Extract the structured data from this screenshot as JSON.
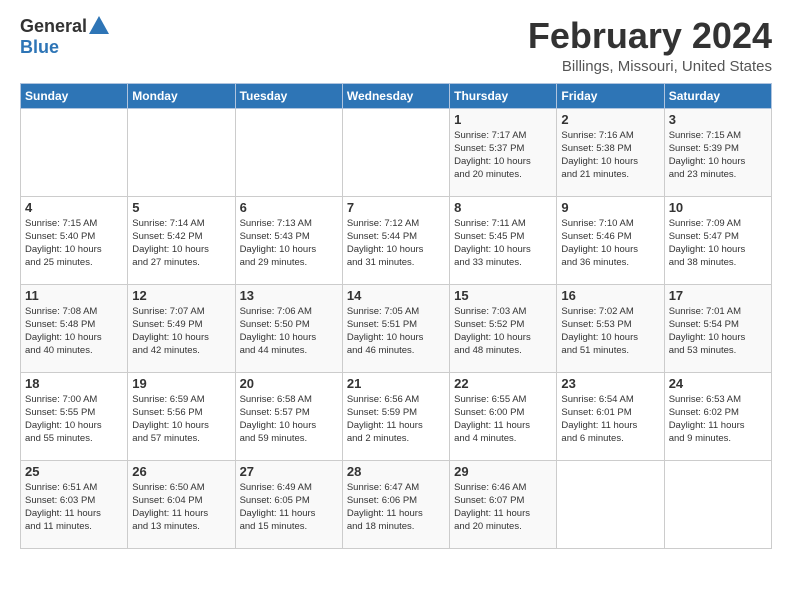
{
  "logo": {
    "general": "General",
    "blue": "Blue"
  },
  "title": "February 2024",
  "subtitle": "Billings, Missouri, United States",
  "days_header": [
    "Sunday",
    "Monday",
    "Tuesday",
    "Wednesday",
    "Thursday",
    "Friday",
    "Saturday"
  ],
  "weeks": [
    [
      {
        "day": "",
        "info": ""
      },
      {
        "day": "",
        "info": ""
      },
      {
        "day": "",
        "info": ""
      },
      {
        "day": "",
        "info": ""
      },
      {
        "day": "1",
        "info": "Sunrise: 7:17 AM\nSunset: 5:37 PM\nDaylight: 10 hours\nand 20 minutes."
      },
      {
        "day": "2",
        "info": "Sunrise: 7:16 AM\nSunset: 5:38 PM\nDaylight: 10 hours\nand 21 minutes."
      },
      {
        "day": "3",
        "info": "Sunrise: 7:15 AM\nSunset: 5:39 PM\nDaylight: 10 hours\nand 23 minutes."
      }
    ],
    [
      {
        "day": "4",
        "info": "Sunrise: 7:15 AM\nSunset: 5:40 PM\nDaylight: 10 hours\nand 25 minutes."
      },
      {
        "day": "5",
        "info": "Sunrise: 7:14 AM\nSunset: 5:42 PM\nDaylight: 10 hours\nand 27 minutes."
      },
      {
        "day": "6",
        "info": "Sunrise: 7:13 AM\nSunset: 5:43 PM\nDaylight: 10 hours\nand 29 minutes."
      },
      {
        "day": "7",
        "info": "Sunrise: 7:12 AM\nSunset: 5:44 PM\nDaylight: 10 hours\nand 31 minutes."
      },
      {
        "day": "8",
        "info": "Sunrise: 7:11 AM\nSunset: 5:45 PM\nDaylight: 10 hours\nand 33 minutes."
      },
      {
        "day": "9",
        "info": "Sunrise: 7:10 AM\nSunset: 5:46 PM\nDaylight: 10 hours\nand 36 minutes."
      },
      {
        "day": "10",
        "info": "Sunrise: 7:09 AM\nSunset: 5:47 PM\nDaylight: 10 hours\nand 38 minutes."
      }
    ],
    [
      {
        "day": "11",
        "info": "Sunrise: 7:08 AM\nSunset: 5:48 PM\nDaylight: 10 hours\nand 40 minutes."
      },
      {
        "day": "12",
        "info": "Sunrise: 7:07 AM\nSunset: 5:49 PM\nDaylight: 10 hours\nand 42 minutes."
      },
      {
        "day": "13",
        "info": "Sunrise: 7:06 AM\nSunset: 5:50 PM\nDaylight: 10 hours\nand 44 minutes."
      },
      {
        "day": "14",
        "info": "Sunrise: 7:05 AM\nSunset: 5:51 PM\nDaylight: 10 hours\nand 46 minutes."
      },
      {
        "day": "15",
        "info": "Sunrise: 7:03 AM\nSunset: 5:52 PM\nDaylight: 10 hours\nand 48 minutes."
      },
      {
        "day": "16",
        "info": "Sunrise: 7:02 AM\nSunset: 5:53 PM\nDaylight: 10 hours\nand 51 minutes."
      },
      {
        "day": "17",
        "info": "Sunrise: 7:01 AM\nSunset: 5:54 PM\nDaylight: 10 hours\nand 53 minutes."
      }
    ],
    [
      {
        "day": "18",
        "info": "Sunrise: 7:00 AM\nSunset: 5:55 PM\nDaylight: 10 hours\nand 55 minutes."
      },
      {
        "day": "19",
        "info": "Sunrise: 6:59 AM\nSunset: 5:56 PM\nDaylight: 10 hours\nand 57 minutes."
      },
      {
        "day": "20",
        "info": "Sunrise: 6:58 AM\nSunset: 5:57 PM\nDaylight: 10 hours\nand 59 minutes."
      },
      {
        "day": "21",
        "info": "Sunrise: 6:56 AM\nSunset: 5:59 PM\nDaylight: 11 hours\nand 2 minutes."
      },
      {
        "day": "22",
        "info": "Sunrise: 6:55 AM\nSunset: 6:00 PM\nDaylight: 11 hours\nand 4 minutes."
      },
      {
        "day": "23",
        "info": "Sunrise: 6:54 AM\nSunset: 6:01 PM\nDaylight: 11 hours\nand 6 minutes."
      },
      {
        "day": "24",
        "info": "Sunrise: 6:53 AM\nSunset: 6:02 PM\nDaylight: 11 hours\nand 9 minutes."
      }
    ],
    [
      {
        "day": "25",
        "info": "Sunrise: 6:51 AM\nSunset: 6:03 PM\nDaylight: 11 hours\nand 11 minutes."
      },
      {
        "day": "26",
        "info": "Sunrise: 6:50 AM\nSunset: 6:04 PM\nDaylight: 11 hours\nand 13 minutes."
      },
      {
        "day": "27",
        "info": "Sunrise: 6:49 AM\nSunset: 6:05 PM\nDaylight: 11 hours\nand 15 minutes."
      },
      {
        "day": "28",
        "info": "Sunrise: 6:47 AM\nSunset: 6:06 PM\nDaylight: 11 hours\nand 18 minutes."
      },
      {
        "day": "29",
        "info": "Sunrise: 6:46 AM\nSunset: 6:07 PM\nDaylight: 11 hours\nand 20 minutes."
      },
      {
        "day": "",
        "info": ""
      },
      {
        "day": "",
        "info": ""
      }
    ]
  ]
}
